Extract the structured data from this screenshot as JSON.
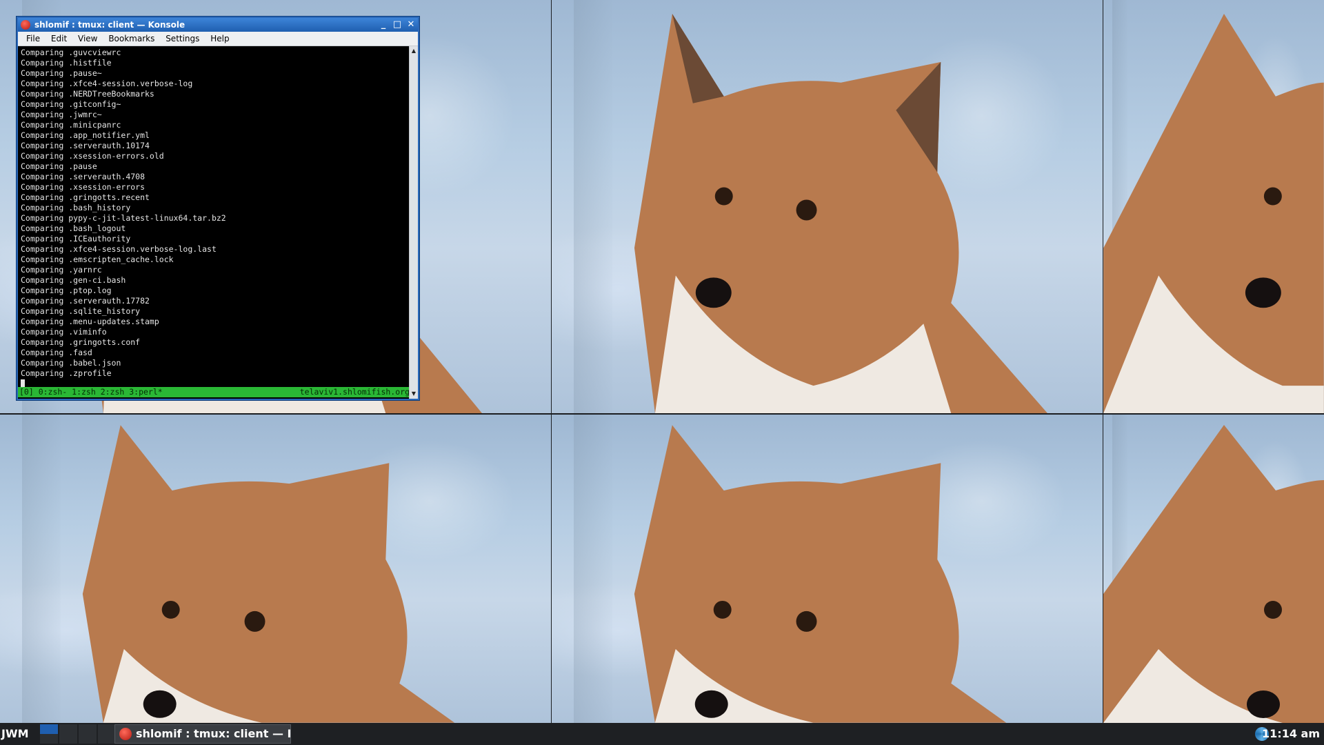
{
  "window": {
    "title": "shlomif : tmux: client — Konsole",
    "menu": [
      "File",
      "Edit",
      "View",
      "Bookmarks",
      "Settings",
      "Help"
    ]
  },
  "terminal": {
    "lines": [
      "Comparing .guvcviewrc",
      "Comparing .histfile",
      "Comparing .pause~",
      "Comparing .xfce4-session.verbose-log",
      "Comparing .NERDTreeBookmarks",
      "Comparing .gitconfig~",
      "Comparing .jwmrc~",
      "Comparing .minicpanrc",
      "Comparing .app_notifier.yml",
      "Comparing .serverauth.10174",
      "Comparing .xsession-errors.old",
      "Comparing .pause",
      "Comparing .serverauth.4708",
      "Comparing .xsession-errors",
      "Comparing .gringotts.recent",
      "Comparing .bash_history",
      "Comparing pypy-c-jit-latest-linux64.tar.bz2",
      "Comparing .bash_logout",
      "Comparing .ICEauthority",
      "Comparing .xfce4-session.verbose-log.last",
      "Comparing .emscripten_cache.lock",
      "Comparing .yarnrc",
      "Comparing .gen-ci.bash",
      "Comparing .ptop.log",
      "Comparing .serverauth.17782",
      "Comparing .sqlite_history",
      "Comparing .menu-updates.stamp",
      "Comparing .viminfo",
      "Comparing .gringotts.conf",
      "Comparing .fasd",
      "Comparing .babel.json",
      "Comparing .zprofile"
    ]
  },
  "tmux_status": {
    "left": "[0] 0:zsh- 1:zsh  2:zsh  3:perl*",
    "right": "telaviv1.shlomifish.org"
  },
  "taskbar": {
    "label": "JWM",
    "task_title": "shlomif : tmux: client — Konsole",
    "clock": "11:14 am"
  },
  "colors": {
    "titlebar": "#1f5fb0",
    "tmux_status": "#2ab735",
    "terminal_bg": "#000000"
  }
}
